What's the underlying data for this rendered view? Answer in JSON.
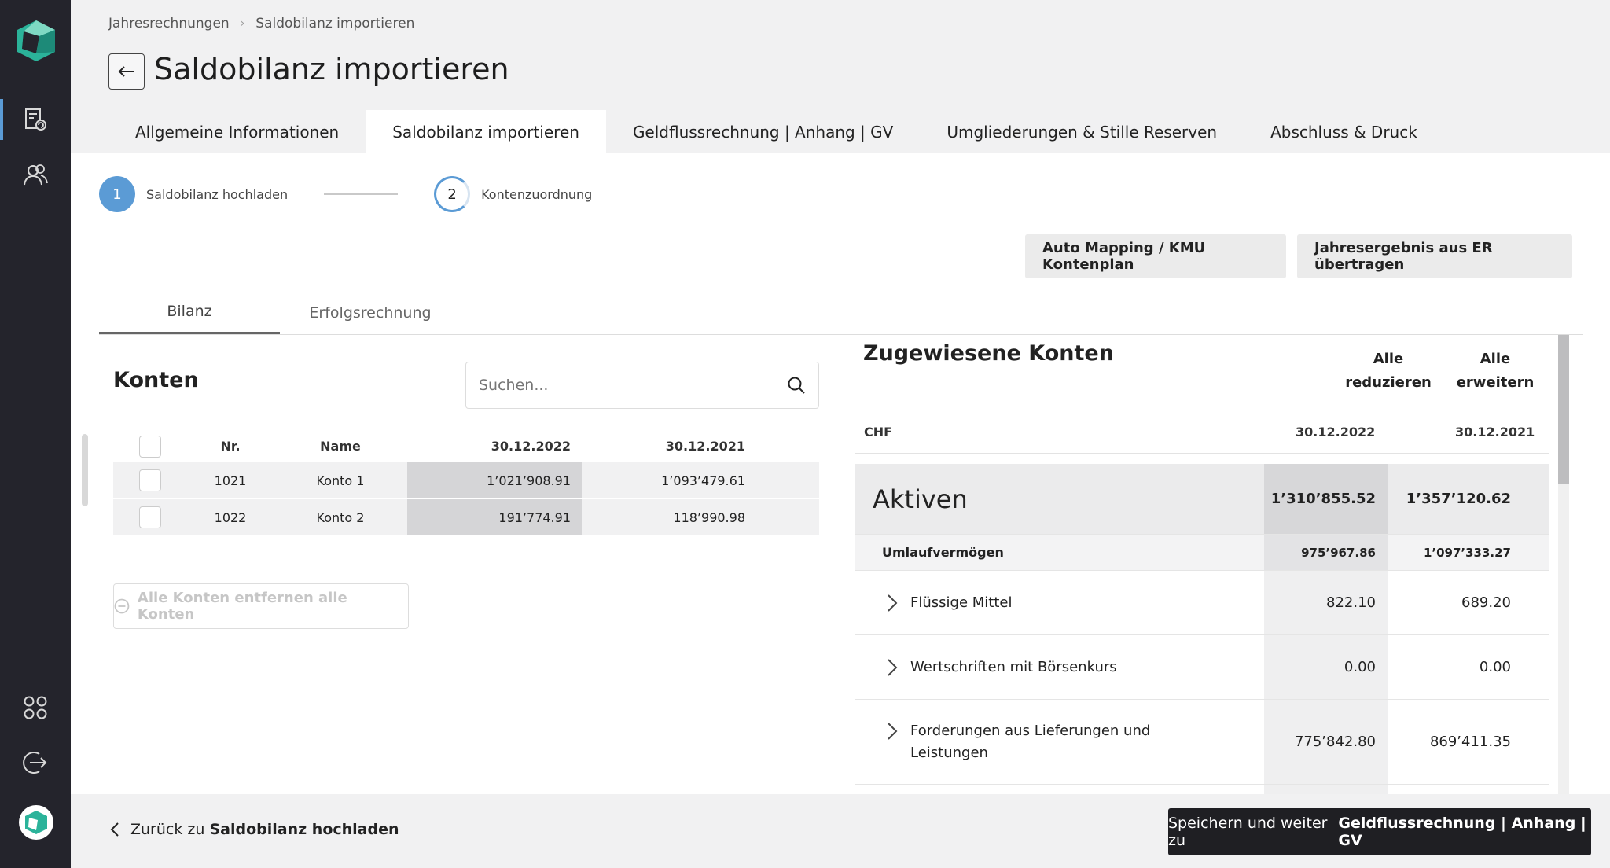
{
  "breadcrumb": {
    "items": [
      "Jahresrechnungen",
      "Saldobilanz importieren"
    ],
    "separator": "›"
  },
  "page": {
    "title": "Saldobilanz importieren"
  },
  "tabs": [
    {
      "label": "Allgemeine Informationen",
      "active": false
    },
    {
      "label": "Saldobilanz importieren",
      "active": true
    },
    {
      "label": "Geldflussrechnung | Anhang | GV",
      "active": false
    },
    {
      "label": "Umgliederungen & Stille Reserven",
      "active": false
    },
    {
      "label": "Abschluss & Druck",
      "active": false
    }
  ],
  "stepper": {
    "steps": [
      {
        "number": "1",
        "label": "Saldobilanz hochladen",
        "state": "done"
      },
      {
        "number": "2",
        "label": "Kontenzuordnung",
        "state": "current"
      }
    ]
  },
  "actions": {
    "auto_mapping": "Auto Mapping / KMU Kontenplan",
    "jahresergebnis": "Jahresergebnis aus ER übertragen"
  },
  "sub_tabs": [
    {
      "label": "Bilanz",
      "active": true
    },
    {
      "label": "Erfolgsrechnung",
      "active": false
    }
  ],
  "konten": {
    "title": "Konten",
    "search_placeholder": "Suchen...",
    "columns": {
      "nr": "Nr.",
      "name": "Name",
      "d1": "30.12.2022",
      "d2": "30.12.2021"
    },
    "rows": [
      {
        "nr": "1021",
        "name": "Konto 1",
        "v1": "1’021’908.91",
        "v2": "1’093’479.61"
      },
      {
        "nr": "1022",
        "name": "Konto 2",
        "v1": "191’774.91",
        "v2": "118’990.98"
      }
    ],
    "remove_all": "Alle Konten entfernen alle Konten"
  },
  "zugewiesen": {
    "title": "Zugewiesene Konten",
    "reduce_all": [
      "Alle",
      "reduzieren"
    ],
    "expand_all": [
      "Alle",
      "erweitern"
    ],
    "currency": "CHF",
    "d1": "30.12.2022",
    "d2": "30.12.2021",
    "aktiven": {
      "label": "Aktiven",
      "v1": "1’310’855.52",
      "v2": "1’357’120.62"
    },
    "umlauf": {
      "label": "Umlaufvermögen",
      "v1": "975’967.86",
      "v2": "1’097’333.27"
    },
    "items": [
      {
        "label": "Flüssige Mittel",
        "v1": "822.10",
        "v2": "689.20"
      },
      {
        "label": "Wertschriften mit Börsenkurs",
        "v1": "0.00",
        "v2": "0.00"
      },
      {
        "label": "Forderungen aus Lieferungen und Leistungen",
        "v1": "775’842.80",
        "v2": "869’411.35"
      }
    ]
  },
  "footer": {
    "back_prefix": "Zurück zu",
    "back_target": "Saldobilanz hochladen",
    "next_prefix": "Speichern und weiter zu",
    "next_target": "Geldflussrechnung | Anhang | GV"
  },
  "colors": {
    "accent": "#5b9bd5",
    "sidebar": "#24242c",
    "primary_button": "#1f1f23",
    "logo_teal": "#2bb39a"
  },
  "icons": [
    "logo-icon",
    "reports-icon",
    "users-icon",
    "apps-icon",
    "logout-icon",
    "back-arrow-icon",
    "search-icon",
    "chevron-right-icon",
    "chevron-left-icon",
    "minus-circle-icon"
  ]
}
